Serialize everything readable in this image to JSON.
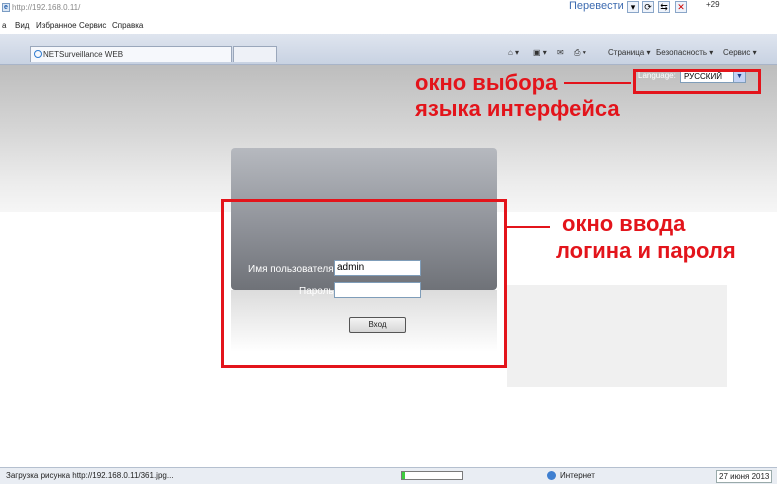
{
  "browser": {
    "address": "http://192.168.0.11/",
    "translate": "Перевести",
    "weather": "+29",
    "menu": [
      "а",
      "Вид",
      "Избранное",
      "Сервис",
      "Справка"
    ],
    "tab_title": "NETSurveillance WEB",
    "commands": [
      "Страница ▾",
      "Безопасность ▾",
      "Сервис ▾"
    ]
  },
  "page": {
    "language_label": "Language:",
    "language_value": "РУССКИЙ",
    "username_label": "Имя пользователя",
    "username_value": "admin",
    "password_label": "Пароль",
    "password_value": "",
    "login_button": "Вход"
  },
  "annotations": {
    "lang_line1": "окно выбора",
    "lang_line2": "языка интерфейса",
    "login_line1": "окно ввода",
    "login_line2": "логина и пароля"
  },
  "status": {
    "text": "Загрузка рисунка http://192.168.0.11/361.jpg...",
    "zone": "Интернет",
    "date": "27 июня 2013",
    "progress": 0.05
  },
  "colors": {
    "annotation": "#e3141b"
  }
}
